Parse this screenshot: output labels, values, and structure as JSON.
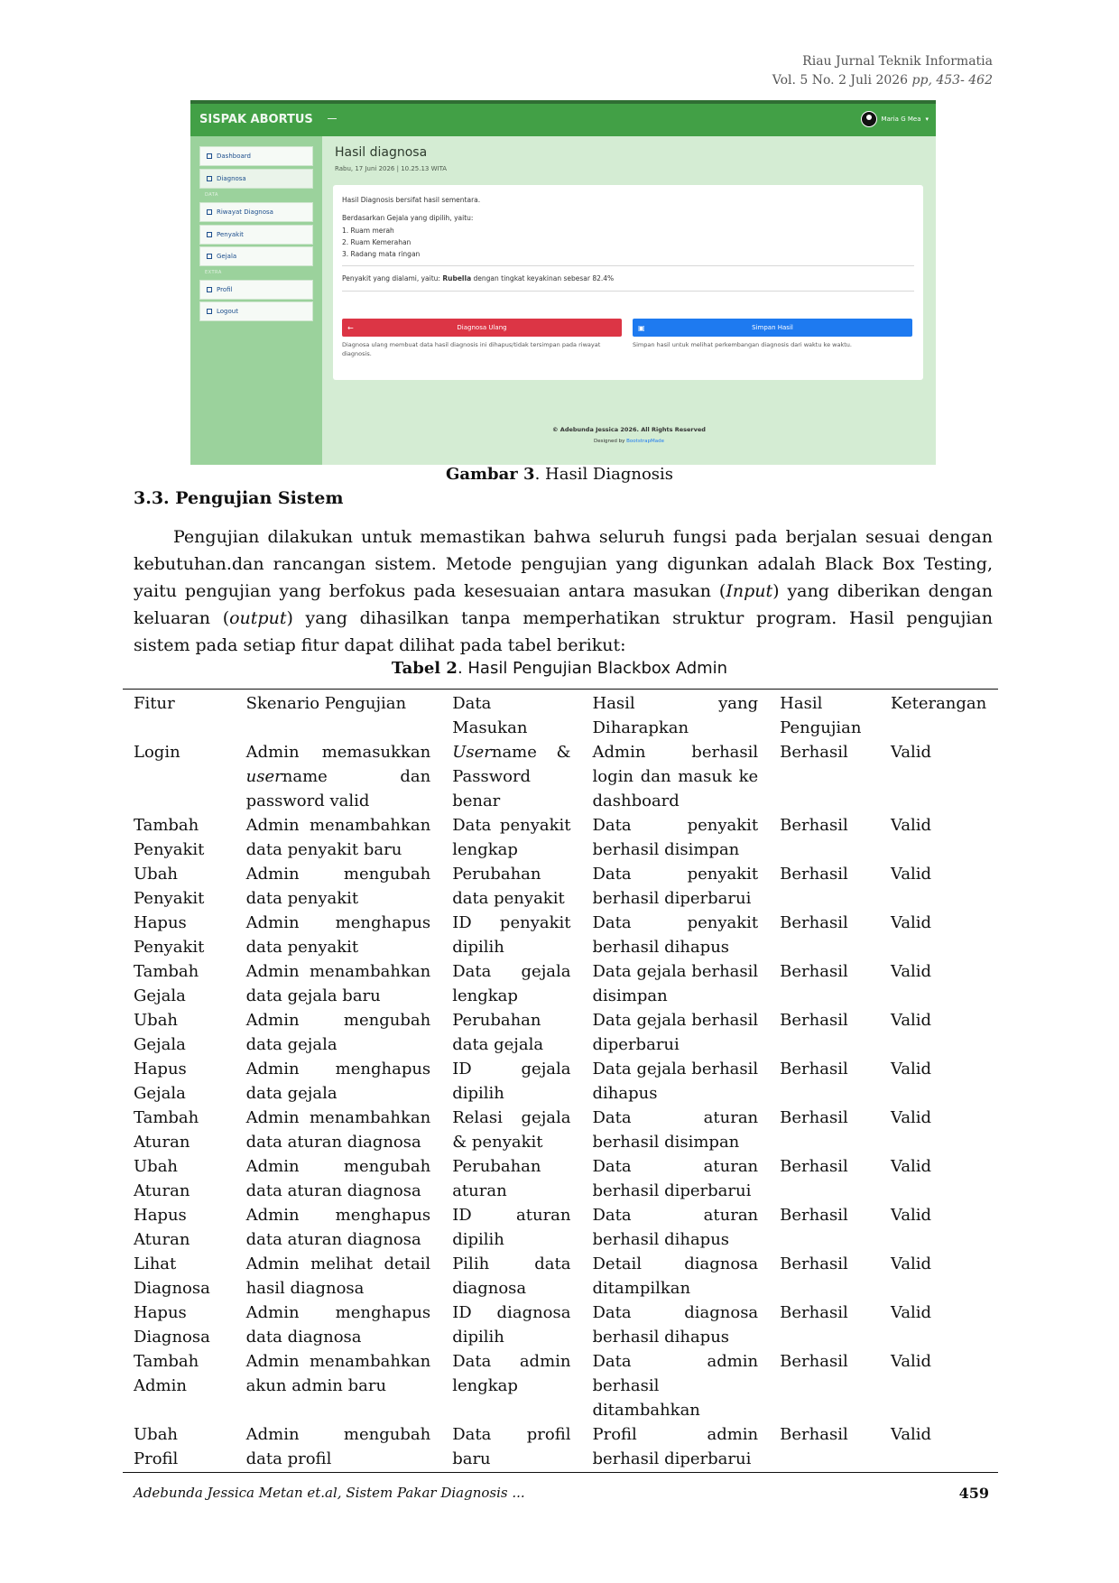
{
  "header": {
    "journal": "Riau Jurnal Teknik Informatia",
    "volume": "Vol. 5 No. 2 Juli 2026",
    "pages": "pp, 453- 462"
  },
  "screenshot": {
    "brand": "SISPAK ABORTUS",
    "user": "Maria G Mea",
    "sidebar": {
      "items": [
        {
          "label": "Dashboard"
        },
        {
          "label": "Diagnosa"
        },
        {
          "label": "Riwayat Diagnosa"
        },
        {
          "label": "Penyakit"
        },
        {
          "label": "Gejala"
        },
        {
          "label": "Profil"
        },
        {
          "label": "Logout"
        }
      ],
      "heading_data": "DATA",
      "heading_extra": "EXTRA"
    },
    "page_title": "Hasil diagnosa",
    "date": "Rabu, 17 Juni 2026 | 10.25.13 WITA",
    "card": {
      "notice": "Hasil Diagnosis bersifat hasil sementara.",
      "intro": "Berdasarkan Gejala yang dipilih, yaitu:",
      "symptoms": [
        "1. Ruam merah",
        "2. Ruam Kemerahan",
        "3. Radang mata ringan"
      ],
      "result_prefix": "Penyakit yang dialami, yaitu:",
      "result_disease": "Rubella",
      "result_suffix": "dengan tingkat keyakinan sebesar 82.4%",
      "btn_retry": "Diagnosa Ulang",
      "btn_save": "Simpan Hasil",
      "retry_note": "Diagnosa ulang membuat data hasil diagnosis ini dihapus/tidak tersimpan pada riwayat diagnosis.",
      "save_note": "Simpan hasil untuk melihat perkembangan diagnosis dari waktu ke waktu."
    },
    "footer_copy": "© Adebunda Jessica 2026. All Rights Reserved",
    "footer_design_prefix": "Designed by",
    "footer_design_link": "BootstrapMade"
  },
  "figure_caption": {
    "label": "Gambar 3",
    "text": ". Hasil Diagnosis"
  },
  "section_title": "3.3. Pengujian Sistem",
  "paragraph": {
    "p1": "Pengujian dilakukan untuk memastikan bahwa seluruh fungsi pada berjalan sesuai dengan kebutuhan.dan rancangan sistem. Metode pengujian yang digunkan adalah  Black Box Testing, yaitu pengujian yang berfokus pada kesesuaian antara masukan (",
    "input": "Input",
    "p2": ") yang diberikan dengan keluaran (",
    "output": "output",
    "p3": ") yang dihasilkan tanpa memperhatikan struktur program. Hasil pengujian sistem pada setiap fitur dapat dilihat pada tabel berikut:"
  },
  "table_caption": {
    "label": "Tabel 2",
    "text": ". Hasil Pengujian Blackbox Admin"
  },
  "table": {
    "headers": [
      "Fitur",
      "Skenario Pengujian",
      "Data Masukan",
      "Hasil yang Diharapkan",
      "Hasil Pengujian",
      "Keterangan"
    ],
    "login": {
      "fitur": "Login",
      "skenario_a": "Admin memasukkan ",
      "skenario_i": "user",
      "skenario_b": "name dan password valid",
      "data_i": "User",
      "data_b": "name & Password benar",
      "harap": "Admin berhasil login dan masuk ke dashboard",
      "hasil": "Berhasil",
      "ket": "Valid"
    },
    "rows": [
      [
        "Tambah Penyakit",
        "Admin menambahkan data penyakit baru",
        "Data penyakit lengkap",
        "Data penyakit berhasil disimpan",
        "Berhasil",
        "Valid"
      ],
      [
        "Ubah Penyakit",
        "Admin mengubah data penyakit",
        "Perubahan data penyakit",
        "Data penyakit berhasil diperbarui",
        "Berhasil",
        "Valid"
      ],
      [
        "Hapus Penyakit",
        "Admin menghapus data penyakit",
        "ID penyakit dipilih",
        "Data penyakit berhasil dihapus",
        "Berhasil",
        "Valid"
      ],
      [
        "Tambah Gejala",
        "Admin menambahkan data gejala baru",
        "Data gejala lengkap",
        "Data gejala berhasil disimpan",
        "Berhasil",
        "Valid"
      ],
      [
        "Ubah Gejala",
        "Admin mengubah data gejala",
        "Perubahan data gejala",
        "Data gejala berhasil diperbarui",
        "Berhasil",
        "Valid"
      ],
      [
        "Hapus Gejala",
        "Admin menghapus data gejala",
        "ID gejala dipilih",
        "Data gejala berhasil dihapus",
        "Berhasil",
        "Valid"
      ],
      [
        "Tambah Aturan",
        "Admin menambahkan data aturan diagnosa",
        "Relasi gejala & penyakit",
        "Data aturan berhasil disimpan",
        "Berhasil",
        "Valid"
      ],
      [
        "Ubah Aturan",
        "Admin mengubah data aturan diagnosa",
        "Perubahan aturan",
        "Data aturan berhasil diperbarui",
        "Berhasil",
        "Valid"
      ],
      [
        "Hapus Aturan",
        "Admin menghapus data aturan diagnosa",
        "ID aturan dipilih",
        "Data aturan berhasil dihapus",
        "Berhasil",
        "Valid"
      ],
      [
        "Lihat Diagnosa",
        "Admin melihat detail hasil diagnosa",
        "Pilih data diagnosa",
        "Detail diagnosa ditampilkan",
        "Berhasil",
        "Valid"
      ],
      [
        "Hapus Diagnosa",
        "Admin menghapus data diagnosa",
        "ID diagnosa dipilih",
        "Data diagnosa berhasil dihapus",
        "Berhasil",
        "Valid"
      ],
      [
        "Tambah Admin",
        "Admin menambahkan akun admin baru",
        "Data admin lengkap",
        "Data admin berhasil ditambahkan",
        "Berhasil",
        "Valid"
      ],
      [
        "Ubah Profil",
        "Admin mengubah data profil",
        "Data profil baru",
        "Profil admin berhasil diperbarui",
        "Berhasil",
        "Valid"
      ]
    ]
  },
  "footer": {
    "authors": "Adebunda Jessica Metan et.al, Sistem Pakar Diagnosis ...",
    "page_number": "459"
  }
}
